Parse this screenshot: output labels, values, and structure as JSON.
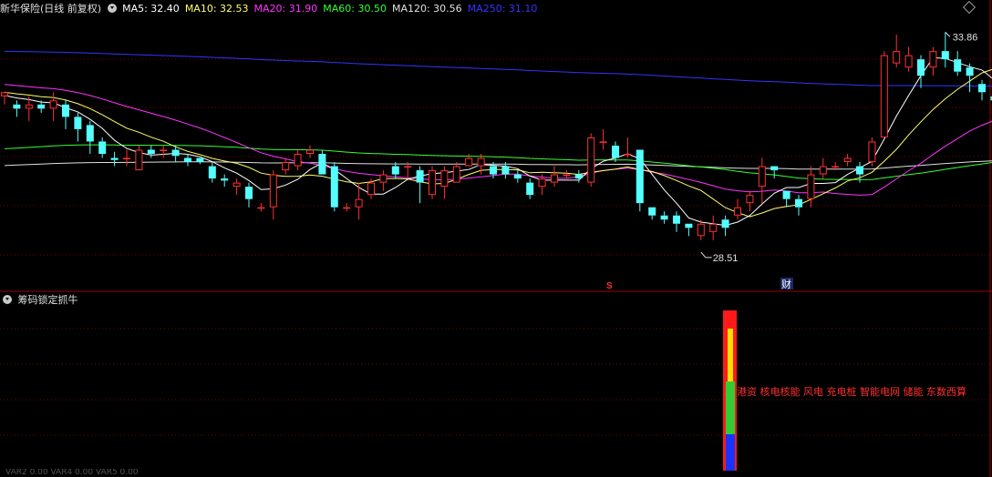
{
  "window": {
    "stock_title": "新华保险(日线 前复权)",
    "sub_indicator_title": "筹码锁定抓牛",
    "sub_indicator_text": "港资 核电核能 风电 充电桩 智能电网 储能 东数西算",
    "bottom_text": "VAR2 0.00 VAR4 0.00 VAR5 0.00"
  },
  "ma_legend": [
    {
      "label": "MA5:",
      "value": "32.40",
      "color": "#ffffff"
    },
    {
      "label": "MA10:",
      "value": "32.53",
      "color": "#ffff66"
    },
    {
      "label": "MA20:",
      "value": "31.90",
      "color": "#ff33ff"
    },
    {
      "label": "MA60:",
      "value": "30.50",
      "color": "#33ff33"
    },
    {
      "label": "MA120:",
      "value": "30.56",
      "color": "#e0e0e0"
    },
    {
      "label": "MA250:",
      "value": "31.10",
      "color": "#3333ff"
    }
  ],
  "annotations": {
    "high_label": "33.86",
    "low_label": "28.51",
    "marker_s": "S",
    "marker_cai": "财"
  },
  "colors": {
    "up": "#ff3232",
    "down": "#54ffff",
    "grid": "#7a0000",
    "separator": "#a00000"
  },
  "chart_data": {
    "type": "candlestick",
    "price_range": [
      27.6,
      34.2
    ],
    "high_price": 33.86,
    "low_price": 28.51,
    "candles": [
      [
        32.3,
        32.4,
        32.1,
        32.2
      ],
      [
        32.1,
        32.0,
        31.8,
        32.2
      ],
      [
        32.0,
        32.1,
        31.7,
        32.3
      ],
      [
        32.1,
        32.0,
        31.9,
        32.2
      ],
      [
        32.0,
        32.2,
        31.7,
        32.4
      ],
      [
        32.1,
        31.8,
        31.5,
        32.2
      ],
      [
        31.8,
        31.5,
        31.2,
        31.9
      ],
      [
        31.6,
        31.2,
        30.9,
        31.7
      ],
      [
        31.2,
        30.9,
        30.8,
        31.3
      ],
      [
        30.8,
        30.75,
        30.6,
        30.95
      ],
      [
        30.8,
        30.8,
        30.6,
        31.0
      ],
      [
        30.5,
        31.0,
        30.6,
        31.1
      ],
      [
        31.0,
        30.9,
        30.8,
        31.1
      ],
      [
        31.0,
        31.0,
        30.8,
        31.1
      ],
      [
        31.0,
        30.85,
        30.7,
        31.1
      ],
      [
        30.8,
        30.7,
        30.6,
        30.9
      ],
      [
        30.8,
        30.7,
        30.65,
        30.8
      ],
      [
        30.6,
        30.3,
        30.2,
        30.7
      ],
      [
        30.3,
        30.25,
        30.1,
        30.4
      ],
      [
        30.1,
        30.2,
        29.9,
        30.3
      ],
      [
        30.1,
        29.8,
        29.6,
        30.2
      ],
      [
        29.6,
        29.6,
        29.5,
        29.7
      ],
      [
        29.6,
        30.4,
        29.3,
        30.5
      ],
      [
        30.5,
        30.7,
        30.4,
        30.8
      ],
      [
        30.6,
        30.9,
        30.5,
        31.0
      ],
      [
        30.9,
        31.0,
        30.8,
        31.1
      ],
      [
        30.9,
        30.4,
        30.4,
        31.0
      ],
      [
        30.6,
        29.6,
        29.5,
        30.7
      ],
      [
        29.6,
        29.6,
        29.5,
        29.7
      ],
      [
        29.6,
        29.8,
        29.3,
        30.2
      ],
      [
        29.9,
        30.2,
        29.8,
        30.3
      ],
      [
        30.2,
        30.4,
        30.0,
        30.5
      ],
      [
        30.6,
        30.4,
        30.3,
        30.7
      ],
      [
        30.6,
        30.6,
        30.3,
        30.7
      ],
      [
        30.5,
        30.2,
        29.7,
        30.6
      ],
      [
        29.9,
        30.5,
        29.8,
        30.6
      ],
      [
        30.1,
        30.5,
        29.8,
        30.6
      ],
      [
        30.2,
        30.6,
        30.2,
        30.7
      ],
      [
        30.6,
        30.8,
        30.6,
        30.9
      ],
      [
        30.6,
        30.8,
        30.4,
        30.9
      ],
      [
        30.6,
        30.4,
        30.3,
        30.7
      ],
      [
        30.6,
        30.4,
        30.3,
        30.7
      ],
      [
        30.4,
        30.3,
        30.2,
        30.5
      ],
      [
        30.2,
        29.9,
        29.8,
        30.3
      ],
      [
        30.1,
        30.3,
        29.9,
        30.4
      ],
      [
        30.2,
        30.4,
        30.1,
        30.6
      ],
      [
        30.4,
        30.4,
        30.3,
        30.5
      ],
      [
        30.4,
        30.3,
        30.2,
        30.5
      ],
      [
        30.2,
        31.3,
        30.1,
        31.4
      ],
      [
        31.2,
        31.2,
        31.0,
        31.5
      ],
      [
        31.1,
        30.8,
        30.7,
        31.2
      ],
      [
        30.9,
        30.9,
        30.8,
        31.3
      ],
      [
        31.0,
        29.7,
        29.5,
        31.0
      ],
      [
        29.6,
        29.4,
        29.3,
        29.6
      ],
      [
        29.4,
        29.3,
        29.2,
        29.5
      ],
      [
        29.4,
        29.2,
        29.0,
        29.5
      ],
      [
        29.2,
        29.1,
        28.9,
        29.2
      ],
      [
        28.9,
        29.2,
        28.8,
        29.3
      ],
      [
        29.0,
        29.2,
        28.8,
        29.4
      ],
      [
        29.3,
        29.1,
        28.9,
        29.4
      ],
      [
        29.4,
        29.6,
        29.3,
        29.8
      ],
      [
        29.7,
        29.9,
        29.5,
        30.0
      ],
      [
        30.1,
        30.6,
        29.7,
        30.8
      ],
      [
        30.6,
        30.5,
        30.3,
        30.6
      ],
      [
        30.0,
        29.8,
        29.6,
        30.0
      ],
      [
        29.8,
        29.6,
        29.4,
        29.9
      ],
      [
        29.8,
        30.4,
        29.6,
        30.6
      ],
      [
        30.4,
        30.6,
        30.3,
        30.8
      ],
      [
        30.6,
        30.6,
        30.5,
        30.7
      ],
      [
        30.7,
        30.8,
        30.6,
        30.9
      ],
      [
        30.6,
        30.4,
        30.2,
        30.7
      ],
      [
        30.7,
        31.2,
        30.6,
        31.3
      ],
      [
        31.3,
        33.3,
        31.4,
        33.4
      ],
      [
        33.1,
        33.4,
        33.0,
        33.8
      ],
      [
        33.0,
        33.3,
        32.9,
        33.5
      ],
      [
        33.2,
        32.8,
        32.5,
        33.3
      ],
      [
        33.0,
        33.4,
        32.8,
        33.5
      ],
      [
        33.4,
        33.2,
        33.0,
        33.86
      ],
      [
        33.2,
        32.9,
        32.8,
        33.4
      ],
      [
        33.0,
        32.8,
        32.4,
        33.1
      ],
      [
        32.6,
        32.4,
        32.2,
        32.7
      ],
      [
        32.3,
        32.2,
        32.0,
        32.5
      ],
      [
        32.2,
        32.6,
        32.1,
        32.7
      ],
      [
        32.3,
        32.5,
        32.2,
        32.8
      ],
      [
        32.6,
        32.8,
        32.5,
        33.1
      ],
      [
        32.6,
        32.9,
        32.5,
        33.2
      ],
      [
        32.9,
        33.1,
        32.8,
        33.2
      ]
    ]
  }
}
